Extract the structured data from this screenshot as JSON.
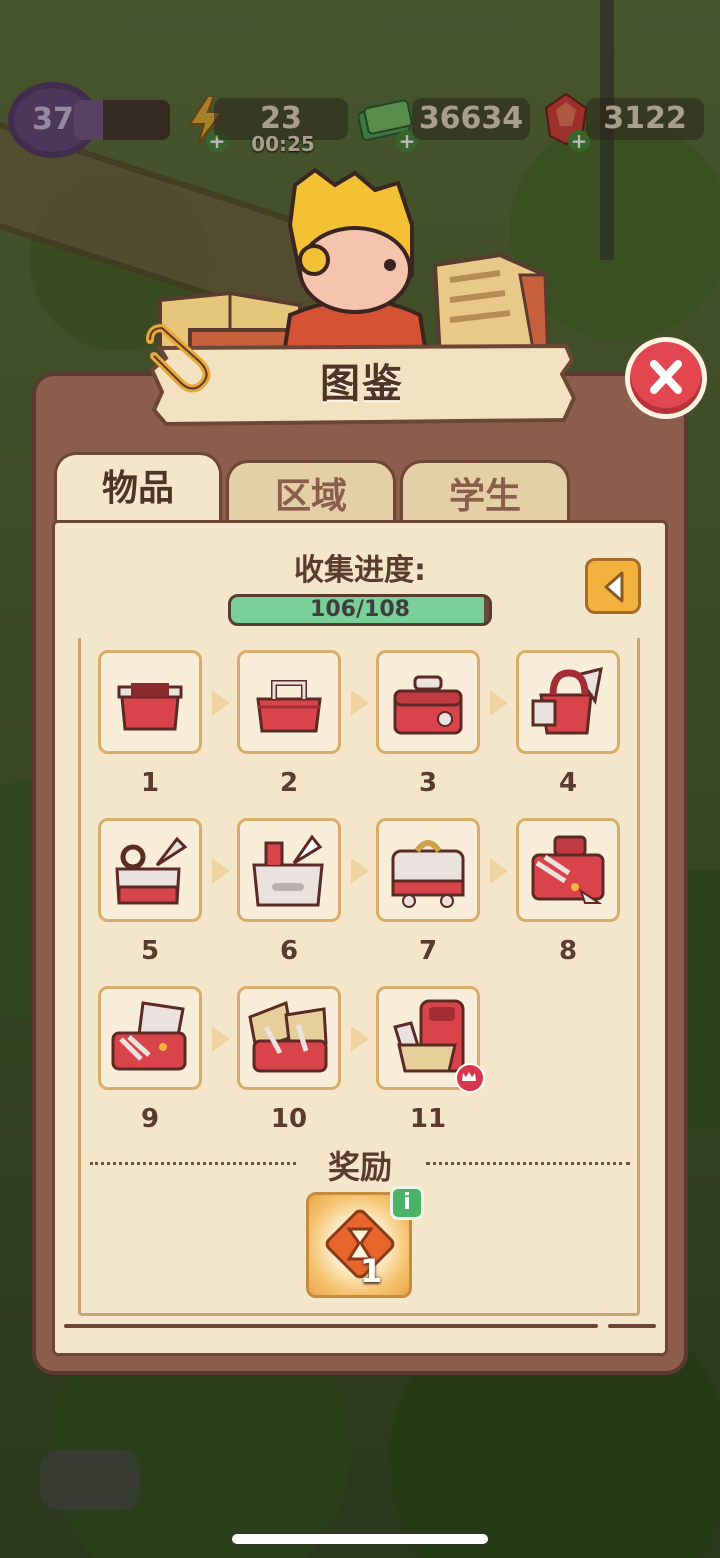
{
  "hud": {
    "level": "37",
    "level_progress": 0.3,
    "energy": "23",
    "energy_timer": "00:25",
    "cash": "36634",
    "gems": "3122"
  },
  "title": "图鉴",
  "tabs": [
    {
      "label": "物品",
      "active": true
    },
    {
      "label": "区域",
      "active": false
    },
    {
      "label": "学生",
      "active": false
    }
  ],
  "progress": {
    "label": "收集进度:",
    "current": 106,
    "total": 108,
    "text": "106/108"
  },
  "items": [
    {
      "num": "1",
      "icon": "red-box-icon"
    },
    {
      "num": "2",
      "icon": "red-toolbox-handle-icon"
    },
    {
      "num": "3",
      "icon": "red-toolbox-lock-icon"
    },
    {
      "num": "4",
      "icon": "red-bag-wings-icon"
    },
    {
      "num": "5",
      "icon": "red-white-kit-icon"
    },
    {
      "num": "6",
      "icon": "white-case-icon"
    },
    {
      "num": "7",
      "icon": "white-chest-icon"
    },
    {
      "num": "8",
      "icon": "red-chest-tools-icon"
    },
    {
      "num": "9",
      "icon": "open-red-case-icon"
    },
    {
      "num": "10",
      "icon": "double-case-icon"
    },
    {
      "num": "11",
      "icon": "backpack-tools-icon",
      "crown": true
    }
  ],
  "reward": {
    "label": "奖励",
    "quantity": "1",
    "info": "i",
    "icon": "hourglass-icon"
  },
  "colors": {
    "panel": "#8a5e4b",
    "paper": "#f4e6cb",
    "progress_fill": "#78cf97",
    "close": "#e2474f",
    "back_button": "#f3b23d"
  }
}
